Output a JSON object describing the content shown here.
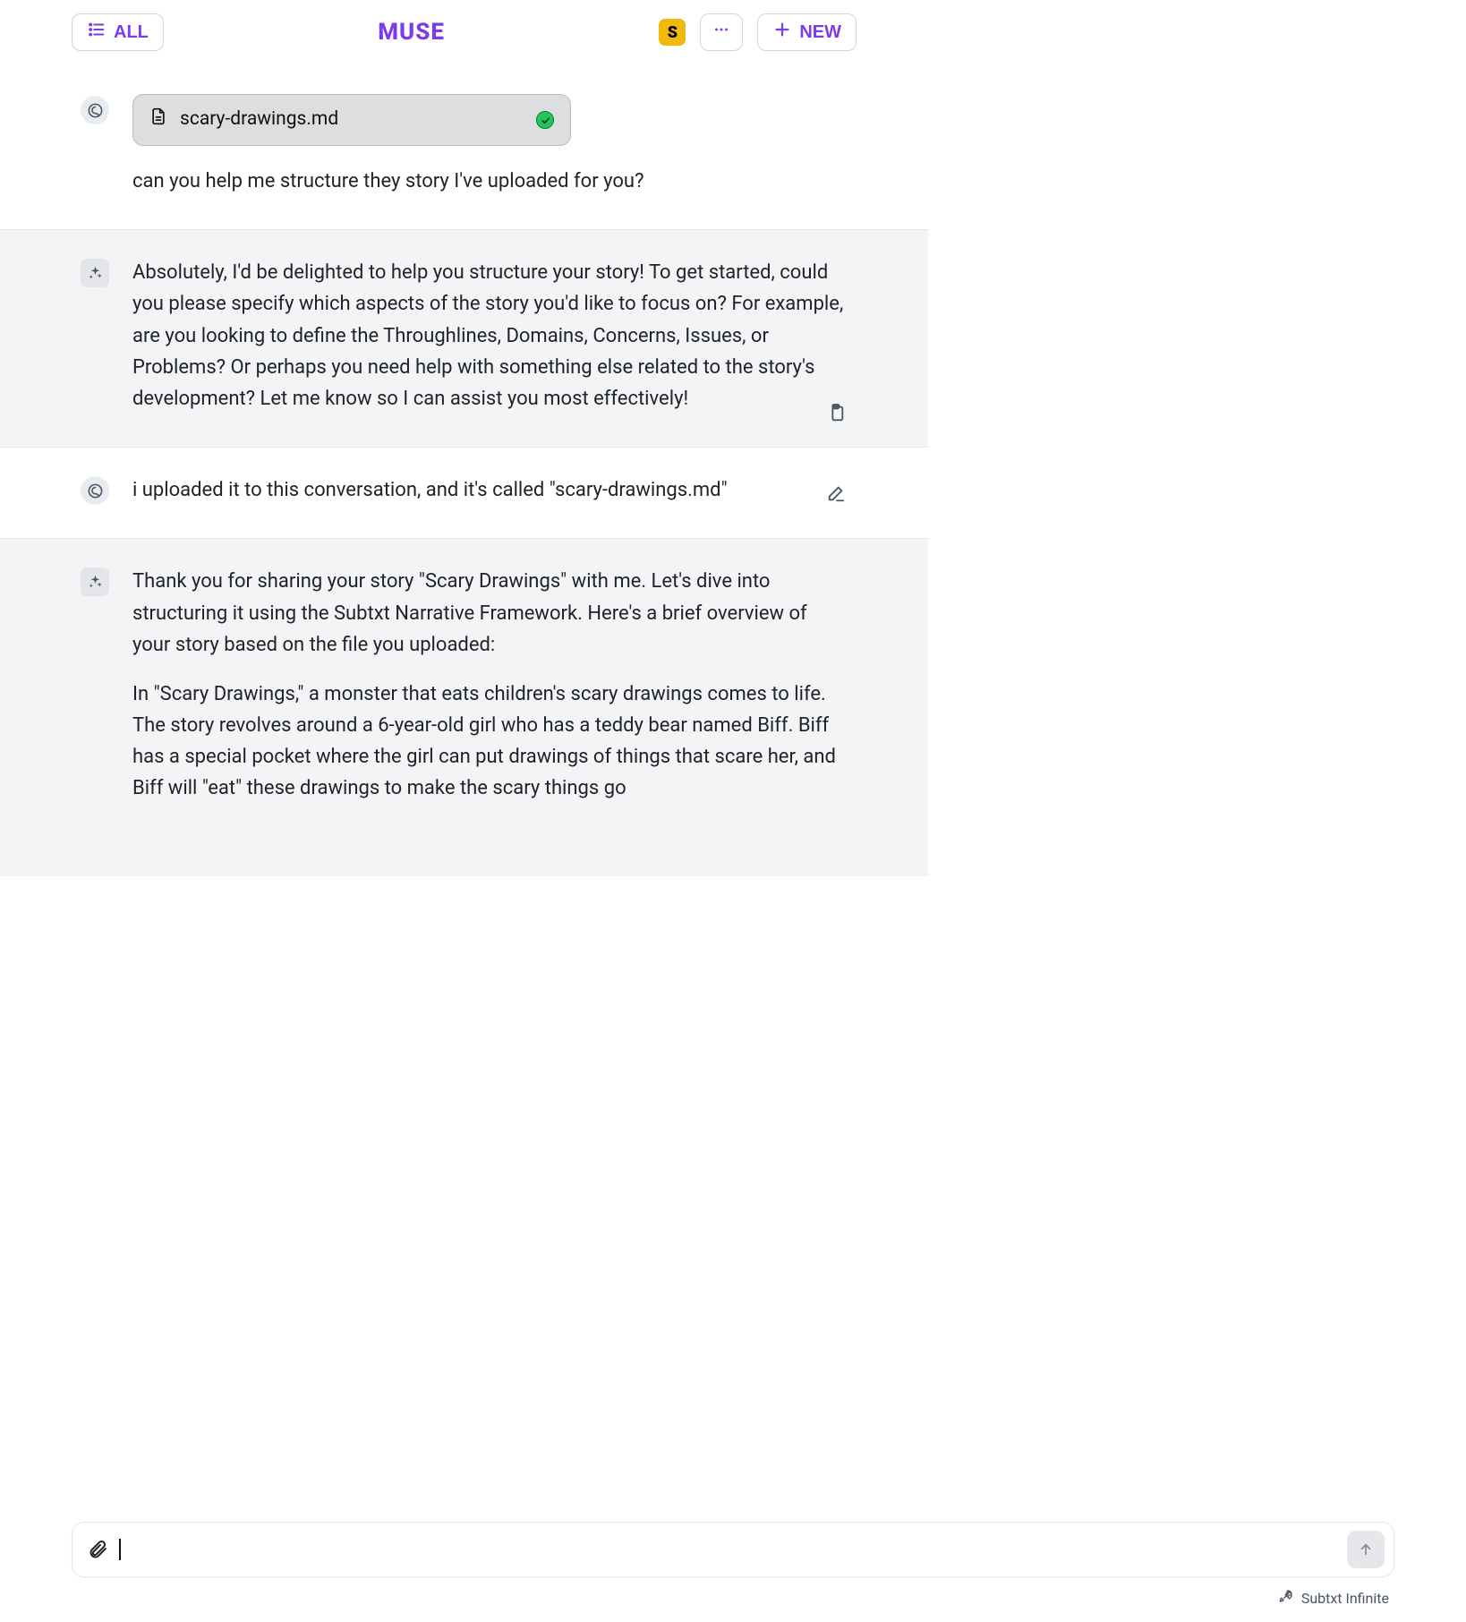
{
  "header": {
    "all_label": "ALL",
    "brand": "MUSE",
    "s_badge": "S",
    "new_label": "NEW"
  },
  "messages": [
    {
      "role": "user",
      "file": {
        "name": "scary-drawings.md"
      },
      "text": "can you help me structure they story I've uploaded for you?"
    },
    {
      "role": "ai",
      "text": "Absolutely, I'd be delighted to help you structure your story! To get started, could you please specify which aspects of the story you'd like to focus on? For example, are you looking to define the Throughlines, Domains, Concerns, Issues, or Problems? Or perhaps you need help with something else related to the story's development? Let me know so I can assist you most effectively!"
    },
    {
      "role": "user",
      "text": "i uploaded it to this conversation, and it's called \"scary-drawings.md\""
    },
    {
      "role": "ai",
      "paragraphs": [
        "Thank you for sharing your story \"Scary Drawings\" with me. Let's dive into structuring it using the Subtxt Narrative Framework. Here's a brief overview of your story based on the file you uploaded:",
        "In \"Scary Drawings,\" a monster that eats children's scary drawings comes to life. The story revolves around a 6-year-old girl who has a teddy bear named Biff. Biff has a special pocket where the girl can put drawings of things that scare her, and Biff will \"eat\" these drawings to make the scary things go"
      ]
    }
  ],
  "composer": {
    "placeholder": ""
  },
  "footer": {
    "label": "Subtxt Infinite"
  }
}
